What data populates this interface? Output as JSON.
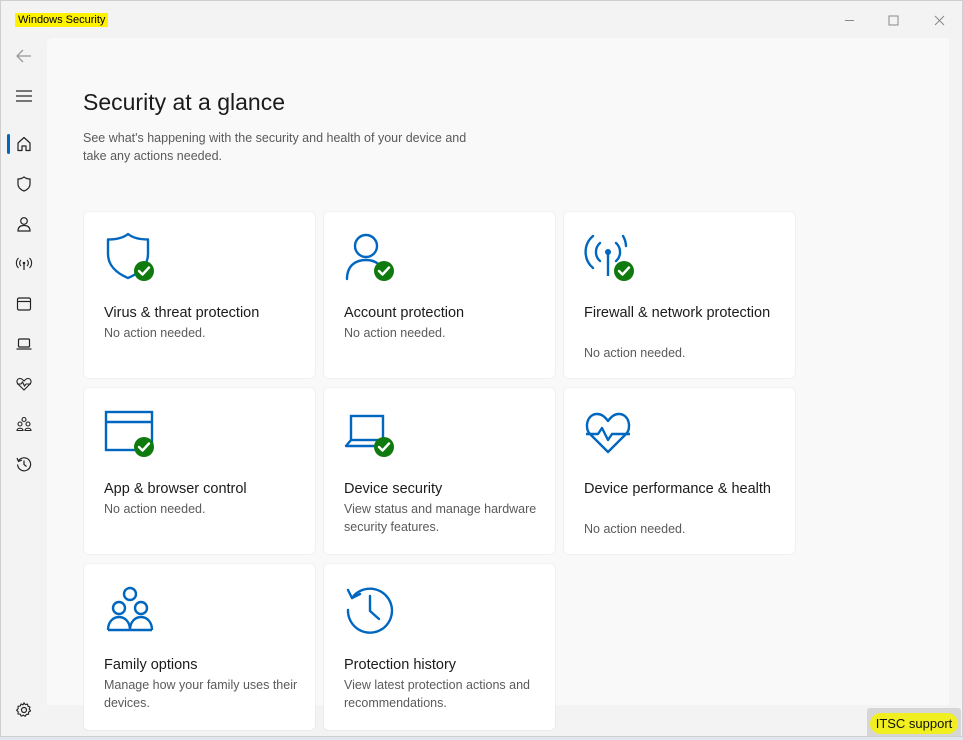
{
  "window": {
    "title": "Windows Security"
  },
  "nav": {
    "items": [
      {
        "name": "back-arrow-icon"
      },
      {
        "name": "hamburger-menu-icon"
      },
      {
        "name": "home-icon",
        "active": true
      },
      {
        "name": "shield-icon"
      },
      {
        "name": "person-icon"
      },
      {
        "name": "wifi-antenna-icon"
      },
      {
        "name": "browser-window-icon"
      },
      {
        "name": "laptop-icon"
      },
      {
        "name": "heart-pulse-icon"
      },
      {
        "name": "family-icon"
      },
      {
        "name": "history-icon"
      }
    ],
    "settings_icon": "gear-icon"
  },
  "main": {
    "title": "Security at a glance",
    "description": "See what's happening with the security and health of your device and take any actions needed.",
    "cards": [
      {
        "title": "Virus & threat protection",
        "subtitle": "No action needed.",
        "icon": "shield-icon",
        "status": "ok"
      },
      {
        "title": "Account protection",
        "subtitle": "No action needed.",
        "icon": "person-icon",
        "status": "ok"
      },
      {
        "title": "Firewall & network protection",
        "subtitle": "No action needed.",
        "icon": "antenna-icon",
        "status": "ok"
      },
      {
        "title": "App & browser control",
        "subtitle": "No action needed.",
        "icon": "browser-window-icon",
        "status": "ok"
      },
      {
        "title": "Device security",
        "subtitle": "View status and manage hardware security features.",
        "icon": "laptop-icon",
        "status": "ok"
      },
      {
        "title": "Device performance & health",
        "subtitle": "No action needed.",
        "icon": "heart-pulse-icon",
        "status": "none"
      },
      {
        "title": "Family options",
        "subtitle": "Manage how your family uses their devices.",
        "icon": "family-icon",
        "status": "none"
      },
      {
        "title": "Protection history",
        "subtitle": "View latest protection actions and recommendations.",
        "icon": "history-icon",
        "status": "none"
      }
    ]
  },
  "taskbar": {
    "itsc_label": "ITSC support"
  },
  "colors": {
    "accent": "#0067c0",
    "ok_green": "#0f7b0f",
    "highlight": "#fff200"
  }
}
